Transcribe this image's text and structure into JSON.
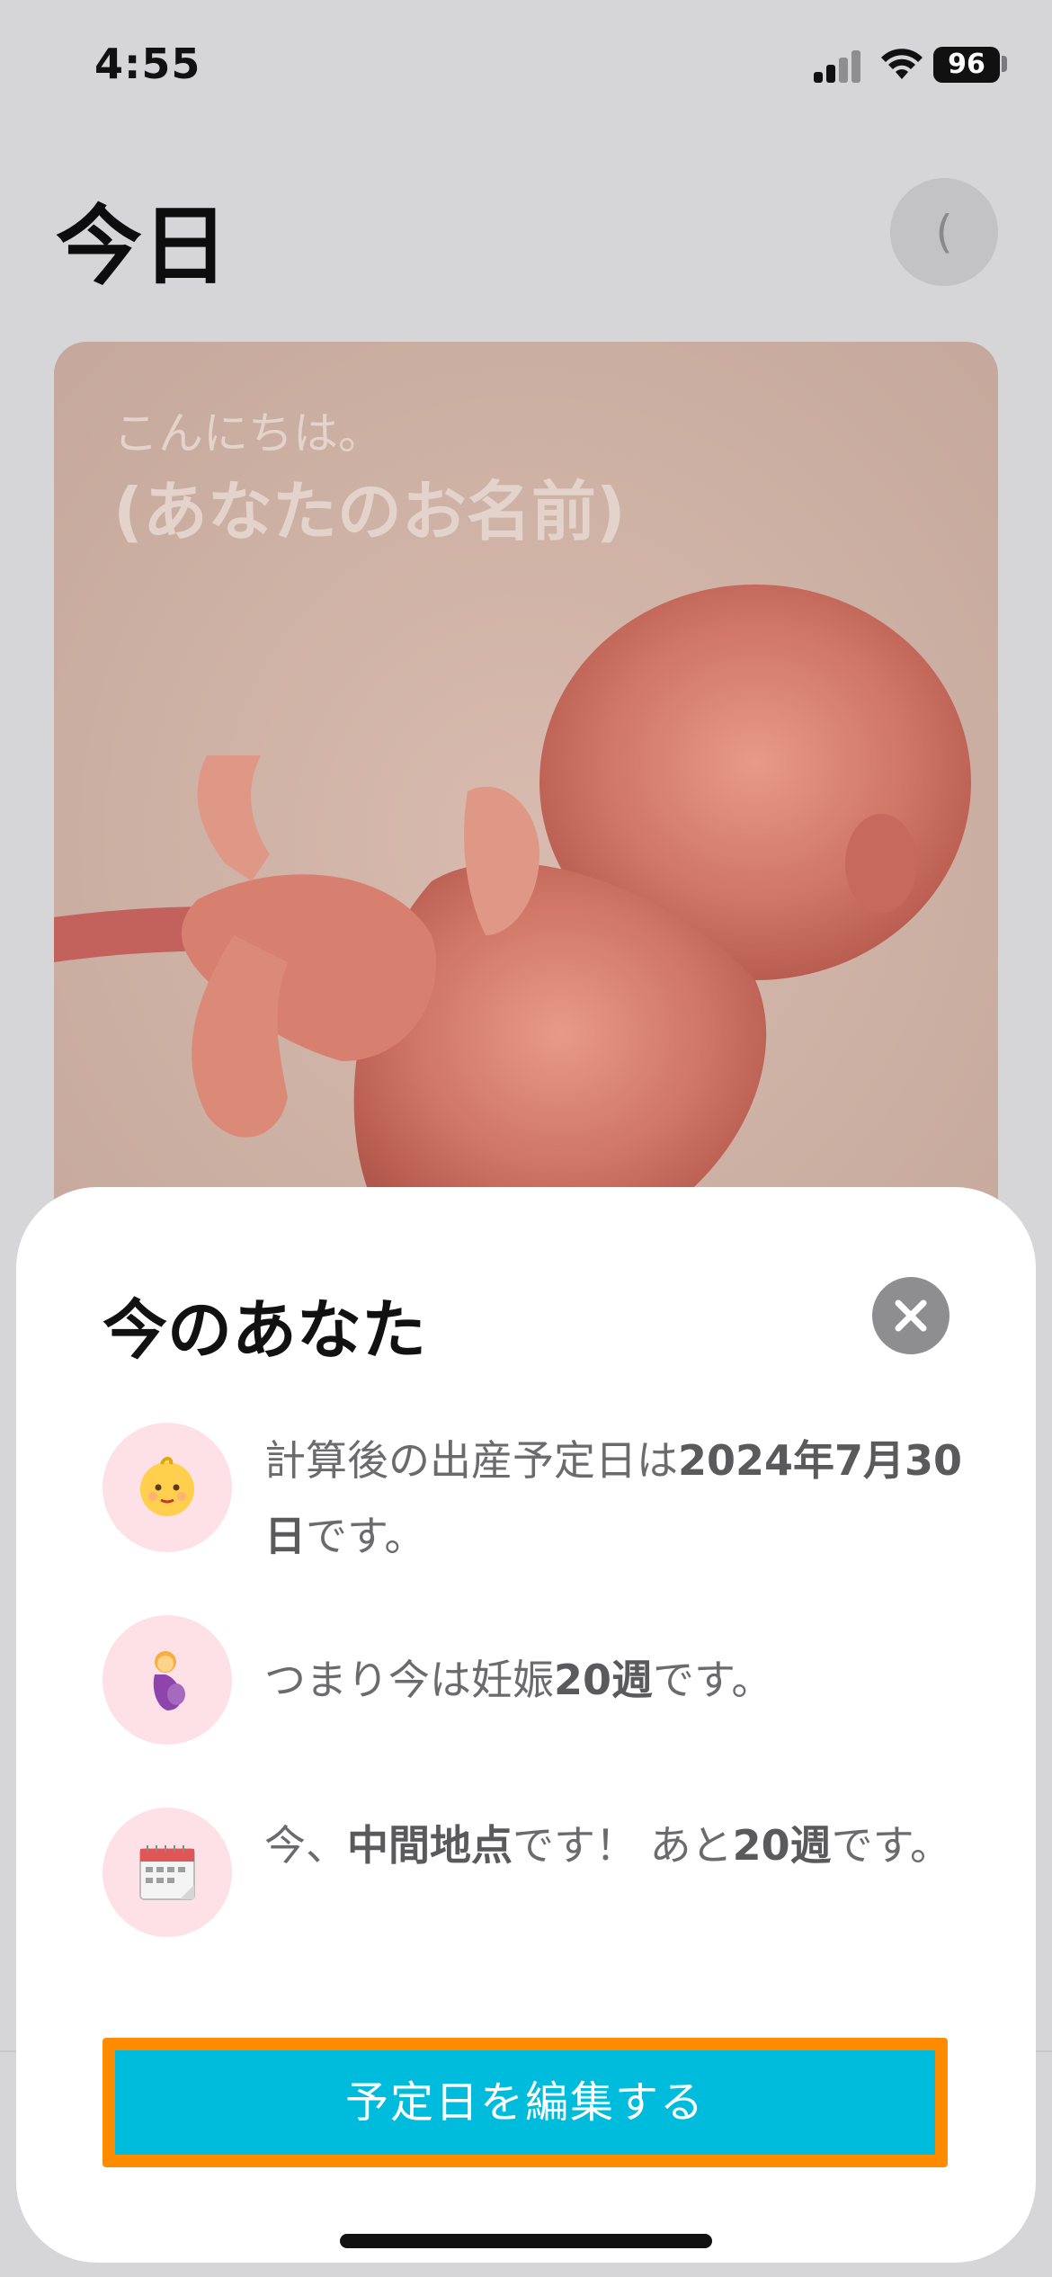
{
  "status_bar": {
    "time": "4:55",
    "battery": "96"
  },
  "header": {
    "title": "今日",
    "avatar_label": "("
  },
  "hero": {
    "greeting": "こんにちは。",
    "name": "(あなたのお名前)"
  },
  "sheet": {
    "title": "今のあなた",
    "rows": [
      {
        "icon": "baby-face-icon",
        "text_before": "計算後の出産予定日は",
        "bold": "2024年7月30日",
        "text_after": "です。"
      },
      {
        "icon": "pregnant-woman-icon",
        "text_before": "つまり今は妊娠",
        "bold": "20週",
        "text_after": "です。"
      },
      {
        "icon": "calendar-icon",
        "text_before": "今、",
        "bold": "中間地点",
        "text_middle": "です！ あと",
        "bold2": "20週",
        "text_after": "です。"
      }
    ],
    "cta_label": "予定日を編集する"
  },
  "colors": {
    "accent": "#00bcdc",
    "highlight": "#ff8c00",
    "icon_bg": "#fde1e7"
  }
}
